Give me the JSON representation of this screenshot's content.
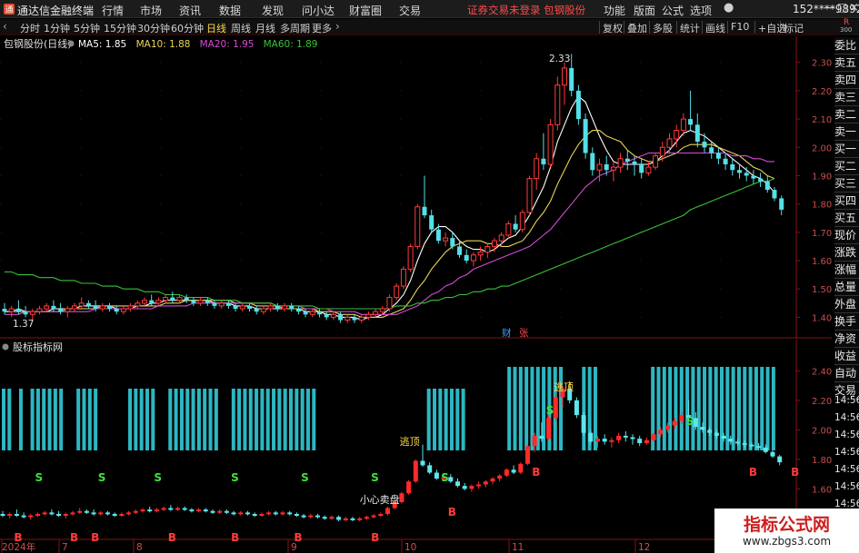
{
  "app": {
    "title": "通达信金融终端",
    "logo_color": "#e64b2b"
  },
  "menu": [
    "行情",
    "市场",
    "资讯",
    "数据",
    "发现",
    "问小达",
    "财富圈",
    "交易"
  ],
  "alert": "证券交易未登录  包钢股份",
  "titlebar_right": [
    "功能",
    "版面",
    "公式",
    "选项"
  ],
  "user": "152****9892",
  "periods": [
    "分时",
    "1分钟",
    "5分钟",
    "15分钟",
    "30分钟",
    "60分钟",
    "日线",
    "周线",
    "月线",
    "多周期",
    "更多"
  ],
  "active_period": "日线",
  "tools": [
    "复权",
    "叠加",
    "多股",
    "统计",
    "画线",
    "F10",
    "+自选",
    "标记"
  ],
  "badge": {
    "top": "R",
    "bottom": "300"
  },
  "main": {
    "stock_label": "包钢股份(日线)",
    "ma_labels": [
      {
        "text": "MA5: 1.85",
        "color": "#ffffff"
      },
      {
        "text": "MA10: 1.88",
        "color": "#e8d35a"
      },
      {
        "text": "MA20: 1.95",
        "color": "#d64bd6"
      },
      {
        "text": "MA60: 1.89",
        "color": "#39c239"
      }
    ],
    "y_ticks": [
      "2.30",
      "2.20",
      "2.10",
      "2.00",
      "1.90",
      "1.80",
      "1.70",
      "1.60",
      "1.50",
      "1.40"
    ],
    "high_label": "2.33",
    "low_label": "1.37",
    "markers": [
      {
        "text": "财",
        "color": "#3fa0ff"
      },
      {
        "text": "张",
        "color": "#ff4a4a"
      }
    ]
  },
  "indicator": {
    "label": "股标指标网",
    "y_ticks": [
      "2.40",
      "2.20",
      "2.00",
      "1.80",
      "1.60",
      "1.40"
    ],
    "signals": {
      "escape": "逃顶",
      "caution": "小心卖盘",
      "s": "S",
      "b": "B"
    }
  },
  "x_axis": [
    "2024年",
    "7",
    "8",
    "9",
    "10",
    "11",
    "12"
  ],
  "side_tabs": [
    "委比",
    "卖五",
    "卖四",
    "卖三",
    "卖二",
    "卖一",
    "买一",
    "买二",
    "买三",
    "买四",
    "买五",
    "现价",
    "涨跌",
    "涨幅",
    "总量",
    "外盘",
    "换手",
    "净资",
    "收益",
    "自动",
    "交易"
  ],
  "side_times": [
    "14:56",
    "14:56",
    "14:56",
    "14:56",
    "14:56",
    "14:56",
    "14:56",
    "14:56"
  ],
  "watermark": {
    "title": "指标公式网",
    "url": "www.zbgs3.com"
  },
  "chart_data": {
    "type": "candlestick",
    "y_range": [
      1.35,
      2.36
    ],
    "ohlc": [
      [
        1.43,
        1.45,
        1.41,
        1.42
      ],
      [
        1.42,
        1.44,
        1.4,
        1.43
      ],
      [
        1.43,
        1.46,
        1.41,
        1.42
      ],
      [
        1.42,
        1.44,
        1.4,
        1.41
      ],
      [
        1.41,
        1.43,
        1.39,
        1.42
      ],
      [
        1.42,
        1.44,
        1.41,
        1.43
      ],
      [
        1.43,
        1.45,
        1.42,
        1.44
      ],
      [
        1.44,
        1.46,
        1.42,
        1.43
      ],
      [
        1.43,
        1.45,
        1.41,
        1.42
      ],
      [
        1.42,
        1.44,
        1.4,
        1.43
      ],
      [
        1.43,
        1.45,
        1.42,
        1.44
      ],
      [
        1.44,
        1.47,
        1.43,
        1.45
      ],
      [
        1.45,
        1.46,
        1.43,
        1.44
      ],
      [
        1.44,
        1.46,
        1.42,
        1.43
      ],
      [
        1.43,
        1.45,
        1.42,
        1.44
      ],
      [
        1.44,
        1.45,
        1.42,
        1.43
      ],
      [
        1.43,
        1.44,
        1.41,
        1.42
      ],
      [
        1.42,
        1.44,
        1.41,
        1.43
      ],
      [
        1.43,
        1.45,
        1.42,
        1.44
      ],
      [
        1.44,
        1.46,
        1.43,
        1.45
      ],
      [
        1.45,
        1.47,
        1.44,
        1.46
      ],
      [
        1.46,
        1.48,
        1.44,
        1.45
      ],
      [
        1.45,
        1.47,
        1.44,
        1.46
      ],
      [
        1.46,
        1.48,
        1.45,
        1.47
      ],
      [
        1.47,
        1.49,
        1.45,
        1.46
      ],
      [
        1.46,
        1.48,
        1.45,
        1.47
      ],
      [
        1.47,
        1.48,
        1.45,
        1.46
      ],
      [
        1.46,
        1.47,
        1.44,
        1.45
      ],
      [
        1.45,
        1.47,
        1.44,
        1.46
      ],
      [
        1.46,
        1.47,
        1.44,
        1.45
      ],
      [
        1.45,
        1.46,
        1.43,
        1.44
      ],
      [
        1.44,
        1.46,
        1.43,
        1.45
      ],
      [
        1.45,
        1.46,
        1.43,
        1.44
      ],
      [
        1.44,
        1.45,
        1.42,
        1.43
      ],
      [
        1.43,
        1.45,
        1.42,
        1.44
      ],
      [
        1.44,
        1.45,
        1.42,
        1.43
      ],
      [
        1.43,
        1.44,
        1.41,
        1.42
      ],
      [
        1.42,
        1.44,
        1.41,
        1.43
      ],
      [
        1.43,
        1.45,
        1.42,
        1.44
      ],
      [
        1.44,
        1.45,
        1.42,
        1.43
      ],
      [
        1.43,
        1.45,
        1.42,
        1.44
      ],
      [
        1.44,
        1.45,
        1.42,
        1.43
      ],
      [
        1.43,
        1.44,
        1.41,
        1.42
      ],
      [
        1.42,
        1.43,
        1.4,
        1.41
      ],
      [
        1.41,
        1.43,
        1.4,
        1.42
      ],
      [
        1.42,
        1.43,
        1.4,
        1.41
      ],
      [
        1.41,
        1.42,
        1.39,
        1.4
      ],
      [
        1.4,
        1.42,
        1.39,
        1.41
      ],
      [
        1.41,
        1.42,
        1.38,
        1.39
      ],
      [
        1.39,
        1.41,
        1.38,
        1.4
      ],
      [
        1.4,
        1.41,
        1.38,
        1.39
      ],
      [
        1.39,
        1.41,
        1.38,
        1.4
      ],
      [
        1.4,
        1.42,
        1.39,
        1.41
      ],
      [
        1.41,
        1.43,
        1.4,
        1.42
      ],
      [
        1.42,
        1.44,
        1.41,
        1.43
      ],
      [
        1.43,
        1.48,
        1.42,
        1.47
      ],
      [
        1.47,
        1.52,
        1.46,
        1.51
      ],
      [
        1.51,
        1.58,
        1.5,
        1.57
      ],
      [
        1.57,
        1.66,
        1.56,
        1.65
      ],
      [
        1.65,
        1.8,
        1.64,
        1.79
      ],
      [
        1.79,
        1.9,
        1.75,
        1.76
      ],
      [
        1.76,
        1.78,
        1.7,
        1.71
      ],
      [
        1.71,
        1.73,
        1.66,
        1.67
      ],
      [
        1.67,
        1.7,
        1.65,
        1.68
      ],
      [
        1.68,
        1.7,
        1.64,
        1.65
      ],
      [
        1.65,
        1.67,
        1.61,
        1.62
      ],
      [
        1.62,
        1.64,
        1.59,
        1.6
      ],
      [
        1.6,
        1.63,
        1.58,
        1.62
      ],
      [
        1.62,
        1.65,
        1.6,
        1.63
      ],
      [
        1.63,
        1.66,
        1.61,
        1.65
      ],
      [
        1.65,
        1.68,
        1.63,
        1.67
      ],
      [
        1.67,
        1.7,
        1.65,
        1.69
      ],
      [
        1.69,
        1.74,
        1.68,
        1.73
      ],
      [
        1.73,
        1.76,
        1.7,
        1.71
      ],
      [
        1.71,
        1.78,
        1.7,
        1.77
      ],
      [
        1.77,
        1.9,
        1.76,
        1.89
      ],
      [
        1.89,
        1.98,
        1.85,
        1.96
      ],
      [
        1.96,
        2.05,
        1.92,
        1.94
      ],
      [
        1.94,
        2.1,
        1.93,
        2.08
      ],
      [
        2.08,
        2.25,
        2.06,
        2.22
      ],
      [
        2.22,
        2.3,
        2.15,
        2.28
      ],
      [
        2.28,
        2.33,
        2.18,
        2.2
      ],
      [
        2.2,
        2.22,
        2.08,
        2.1
      ],
      [
        2.1,
        2.12,
        1.96,
        1.98
      ],
      [
        1.98,
        2.0,
        1.9,
        1.92
      ],
      [
        1.92,
        1.96,
        1.88,
        1.94
      ],
      [
        1.94,
        1.97,
        1.9,
        1.92
      ],
      [
        1.92,
        1.95,
        1.88,
        1.93
      ],
      [
        1.93,
        1.98,
        1.91,
        1.96
      ],
      [
        1.96,
        1.99,
        1.92,
        1.95
      ],
      [
        1.95,
        1.97,
        1.9,
        1.94
      ],
      [
        1.94,
        1.96,
        1.89,
        1.91
      ],
      [
        1.91,
        1.95,
        1.9,
        1.93
      ],
      [
        1.93,
        1.98,
        1.92,
        1.97
      ],
      [
        1.97,
        2.02,
        1.95,
        2.0
      ],
      [
        2.0,
        2.05,
        1.98,
        2.03
      ],
      [
        2.03,
        2.08,
        2.0,
        2.06
      ],
      [
        2.06,
        2.12,
        2.04,
        2.1
      ],
      [
        2.1,
        2.2,
        2.06,
        2.08
      ],
      [
        2.08,
        2.12,
        2.0,
        2.02
      ],
      [
        2.02,
        2.05,
        1.98,
        2.0
      ],
      [
        2.0,
        2.02,
        1.96,
        1.98
      ],
      [
        1.98,
        2.0,
        1.94,
        1.96
      ],
      [
        1.96,
        1.98,
        1.92,
        1.94
      ],
      [
        1.94,
        1.96,
        1.9,
        1.92
      ],
      [
        1.92,
        1.94,
        1.89,
        1.91
      ],
      [
        1.91,
        1.93,
        1.88,
        1.9
      ],
      [
        1.9,
        1.92,
        1.87,
        1.89
      ],
      [
        1.89,
        1.91,
        1.86,
        1.88
      ],
      [
        1.88,
        1.9,
        1.84,
        1.85
      ],
      [
        1.85,
        1.86,
        1.81,
        1.82
      ],
      [
        1.82,
        1.83,
        1.76,
        1.78
      ]
    ],
    "ma": {
      "MA5": {
        "color": "#ffffff",
        "values": [
          1.42,
          1.42,
          1.43,
          1.42,
          1.42,
          1.42,
          1.42,
          1.43,
          1.43,
          1.43,
          1.43,
          1.44,
          1.44,
          1.44,
          1.44,
          1.44,
          1.43,
          1.43,
          1.43,
          1.44,
          1.44,
          1.45,
          1.45,
          1.46,
          1.46,
          1.46,
          1.46,
          1.46,
          1.46,
          1.46,
          1.45,
          1.45,
          1.45,
          1.44,
          1.44,
          1.44,
          1.43,
          1.43,
          1.43,
          1.43,
          1.43,
          1.43,
          1.43,
          1.42,
          1.42,
          1.42,
          1.41,
          1.41,
          1.4,
          1.4,
          1.4,
          1.39,
          1.4,
          1.4,
          1.41,
          1.43,
          1.45,
          1.48,
          1.53,
          1.6,
          1.66,
          1.7,
          1.72,
          1.72,
          1.7,
          1.67,
          1.65,
          1.64,
          1.64,
          1.63,
          1.64,
          1.66,
          1.68,
          1.69,
          1.72,
          1.76,
          1.81,
          1.86,
          1.93,
          2.02,
          2.08,
          2.14,
          2.18,
          2.16,
          2.1,
          2.04,
          1.99,
          1.95,
          1.94,
          1.94,
          1.94,
          1.94,
          1.94,
          1.95,
          1.97,
          1.99,
          2.02,
          2.05,
          2.06,
          2.05,
          2.04,
          2.02,
          2.0,
          1.98,
          1.96,
          1.94,
          1.92,
          1.9,
          1.89,
          1.87,
          1.84
        ]
      },
      "MA10": {
        "color": "#e8d35a",
        "values": [
          1.42,
          1.42,
          1.42,
          1.42,
          1.42,
          1.42,
          1.42,
          1.42,
          1.42,
          1.43,
          1.43,
          1.43,
          1.43,
          1.43,
          1.44,
          1.44,
          1.44,
          1.44,
          1.44,
          1.44,
          1.44,
          1.44,
          1.44,
          1.45,
          1.45,
          1.45,
          1.46,
          1.46,
          1.46,
          1.46,
          1.46,
          1.46,
          1.46,
          1.45,
          1.45,
          1.45,
          1.44,
          1.44,
          1.44,
          1.44,
          1.43,
          1.43,
          1.43,
          1.43,
          1.43,
          1.42,
          1.42,
          1.42,
          1.41,
          1.41,
          1.41,
          1.4,
          1.4,
          1.4,
          1.4,
          1.41,
          1.42,
          1.43,
          1.46,
          1.5,
          1.53,
          1.57,
          1.6,
          1.63,
          1.65,
          1.66,
          1.67,
          1.67,
          1.67,
          1.66,
          1.66,
          1.65,
          1.65,
          1.66,
          1.67,
          1.7,
          1.74,
          1.77,
          1.81,
          1.87,
          1.92,
          1.97,
          2.01,
          2.04,
          2.06,
          2.06,
          2.04,
          2.03,
          2.02,
          1.99,
          1.97,
          1.96,
          1.95,
          1.95,
          1.96,
          1.97,
          1.98,
          2.0,
          2.01,
          2.01,
          2.01,
          2.01,
          2.0,
          1.99,
          1.98,
          1.97,
          1.95,
          1.93,
          1.92,
          1.9,
          1.89
        ]
      },
      "MA20": {
        "color": "#d64bd6",
        "values": [
          1.41,
          1.41,
          1.41,
          1.42,
          1.42,
          1.42,
          1.42,
          1.42,
          1.42,
          1.42,
          1.42,
          1.42,
          1.42,
          1.43,
          1.43,
          1.43,
          1.43,
          1.43,
          1.43,
          1.43,
          1.43,
          1.43,
          1.44,
          1.44,
          1.44,
          1.44,
          1.44,
          1.45,
          1.45,
          1.45,
          1.45,
          1.45,
          1.45,
          1.45,
          1.45,
          1.45,
          1.45,
          1.45,
          1.45,
          1.44,
          1.44,
          1.44,
          1.44,
          1.43,
          1.43,
          1.43,
          1.43,
          1.42,
          1.42,
          1.42,
          1.42,
          1.41,
          1.41,
          1.41,
          1.41,
          1.41,
          1.41,
          1.42,
          1.43,
          1.44,
          1.46,
          1.48,
          1.49,
          1.51,
          1.52,
          1.54,
          1.55,
          1.57,
          1.58,
          1.59,
          1.6,
          1.61,
          1.62,
          1.63,
          1.64,
          1.65,
          1.67,
          1.69,
          1.71,
          1.74,
          1.77,
          1.8,
          1.83,
          1.86,
          1.88,
          1.9,
          1.91,
          1.92,
          1.94,
          1.95,
          1.96,
          1.97,
          1.98,
          1.98,
          1.98,
          1.98,
          1.98,
          1.98,
          1.98,
          1.98,
          1.98,
          1.98,
          1.98,
          1.98,
          1.97,
          1.97,
          1.97,
          1.96,
          1.96,
          1.95,
          1.95
        ]
      },
      "MA60": {
        "color": "#39c239",
        "values": [
          1.56,
          1.56,
          1.55,
          1.55,
          1.55,
          1.54,
          1.54,
          1.54,
          1.53,
          1.53,
          1.53,
          1.52,
          1.52,
          1.52,
          1.51,
          1.51,
          1.51,
          1.5,
          1.5,
          1.5,
          1.49,
          1.49,
          1.49,
          1.48,
          1.48,
          1.48,
          1.47,
          1.47,
          1.47,
          1.47,
          1.46,
          1.46,
          1.46,
          1.46,
          1.45,
          1.45,
          1.45,
          1.45,
          1.45,
          1.44,
          1.44,
          1.44,
          1.44,
          1.44,
          1.44,
          1.43,
          1.43,
          1.43,
          1.43,
          1.43,
          1.43,
          1.43,
          1.43,
          1.43,
          1.43,
          1.43,
          1.44,
          1.44,
          1.44,
          1.45,
          1.45,
          1.46,
          1.46,
          1.47,
          1.47,
          1.48,
          1.48,
          1.49,
          1.49,
          1.5,
          1.5,
          1.51,
          1.51,
          1.52,
          1.53,
          1.54,
          1.55,
          1.56,
          1.57,
          1.58,
          1.59,
          1.6,
          1.61,
          1.62,
          1.63,
          1.64,
          1.65,
          1.66,
          1.67,
          1.68,
          1.69,
          1.7,
          1.71,
          1.72,
          1.73,
          1.74,
          1.75,
          1.76,
          1.78,
          1.79,
          1.8,
          1.81,
          1.82,
          1.83,
          1.84,
          1.85,
          1.86,
          1.87,
          1.88,
          1.88,
          1.89
        ]
      }
    },
    "indicator_bars": [
      1,
      1,
      0,
      1,
      0,
      1,
      1,
      1,
      1,
      1,
      1,
      0,
      0,
      1,
      1,
      1,
      1,
      0,
      0,
      0,
      0,
      0,
      1,
      1,
      1,
      1,
      1,
      0,
      0,
      1,
      1,
      1,
      1,
      1,
      1,
      1,
      1,
      1,
      0,
      0,
      1,
      1,
      1,
      1,
      1,
      1,
      1,
      1,
      1,
      1,
      1,
      1,
      1,
      1,
      1,
      0,
      0,
      0,
      0,
      0,
      0,
      0,
      0,
      0,
      0,
      0,
      0,
      0,
      0,
      0,
      0,
      0,
      0,
      0,
      1,
      1,
      1,
      1,
      1,
      1,
      1,
      0,
      0,
      0,
      0,
      0,
      0,
      0,
      1,
      1,
      1,
      1,
      1,
      1,
      1,
      1,
      1,
      1,
      0,
      0,
      0,
      1,
      1,
      1,
      0,
      0,
      0,
      0,
      0,
      0,
      0,
      0,
      0,
      1,
      1,
      1,
      1,
      1,
      1,
      1,
      1,
      1,
      1,
      1,
      1,
      1,
      1,
      1,
      1,
      1,
      1,
      1,
      1,
      1,
      1
    ],
    "s_signals": [
      5,
      14,
      22,
      33,
      43,
      53,
      63,
      78,
      98,
      120
    ],
    "b_signals": [
      2,
      10,
      13,
      24,
      33,
      42,
      53,
      64,
      76,
      107,
      113
    ],
    "escape_signals": [
      58,
      80
    ],
    "caution_signal": 51
  }
}
